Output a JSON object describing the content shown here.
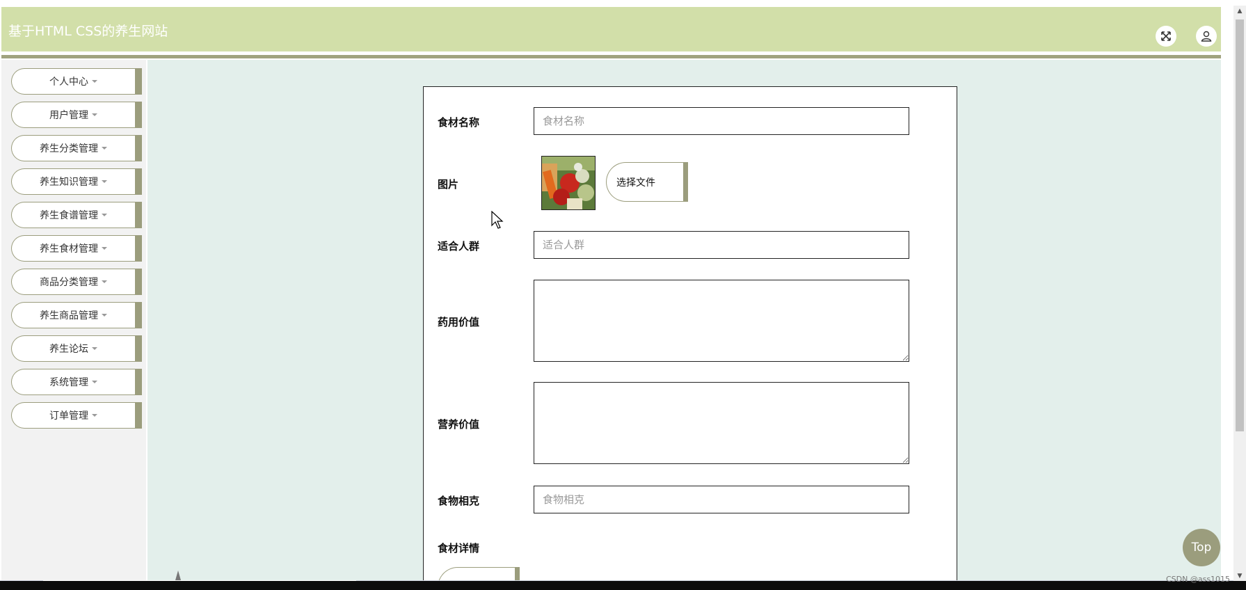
{
  "header": {
    "title": "基于HTML CSS的养生网站",
    "fullscreen_icon": "fullscreen-icon",
    "user_icon": "user-icon"
  },
  "sidebar": {
    "items": [
      {
        "label": "个人中心"
      },
      {
        "label": "用户管理"
      },
      {
        "label": "养生分类管理"
      },
      {
        "label": "养生知识管理"
      },
      {
        "label": "养生食谱管理"
      },
      {
        "label": "养生食材管理"
      },
      {
        "label": "商品分类管理"
      },
      {
        "label": "养生商品管理"
      },
      {
        "label": "养生论坛"
      },
      {
        "label": "系统管理"
      },
      {
        "label": "订单管理"
      }
    ]
  },
  "form": {
    "name_label": "食材名称",
    "name_placeholder": "食材名称",
    "image_label": "图片",
    "choose_file_label": "选择文件",
    "crowd_label": "适合人群",
    "crowd_placeholder": "适合人群",
    "medicinal_label": "药用价值",
    "nutrition_label": "营养价值",
    "incompat_label": "食物相克",
    "incompat_placeholder": "食物相克",
    "detail_label": "食材详情"
  },
  "top_button": "Top",
  "watermark": "CSDN @ass1015",
  "colors": {
    "header_bg": "#d2dfa9",
    "accent": "#9b9d7d",
    "main_bg": "#e3efeb",
    "sidebar_bg": "#f2f2f2"
  }
}
